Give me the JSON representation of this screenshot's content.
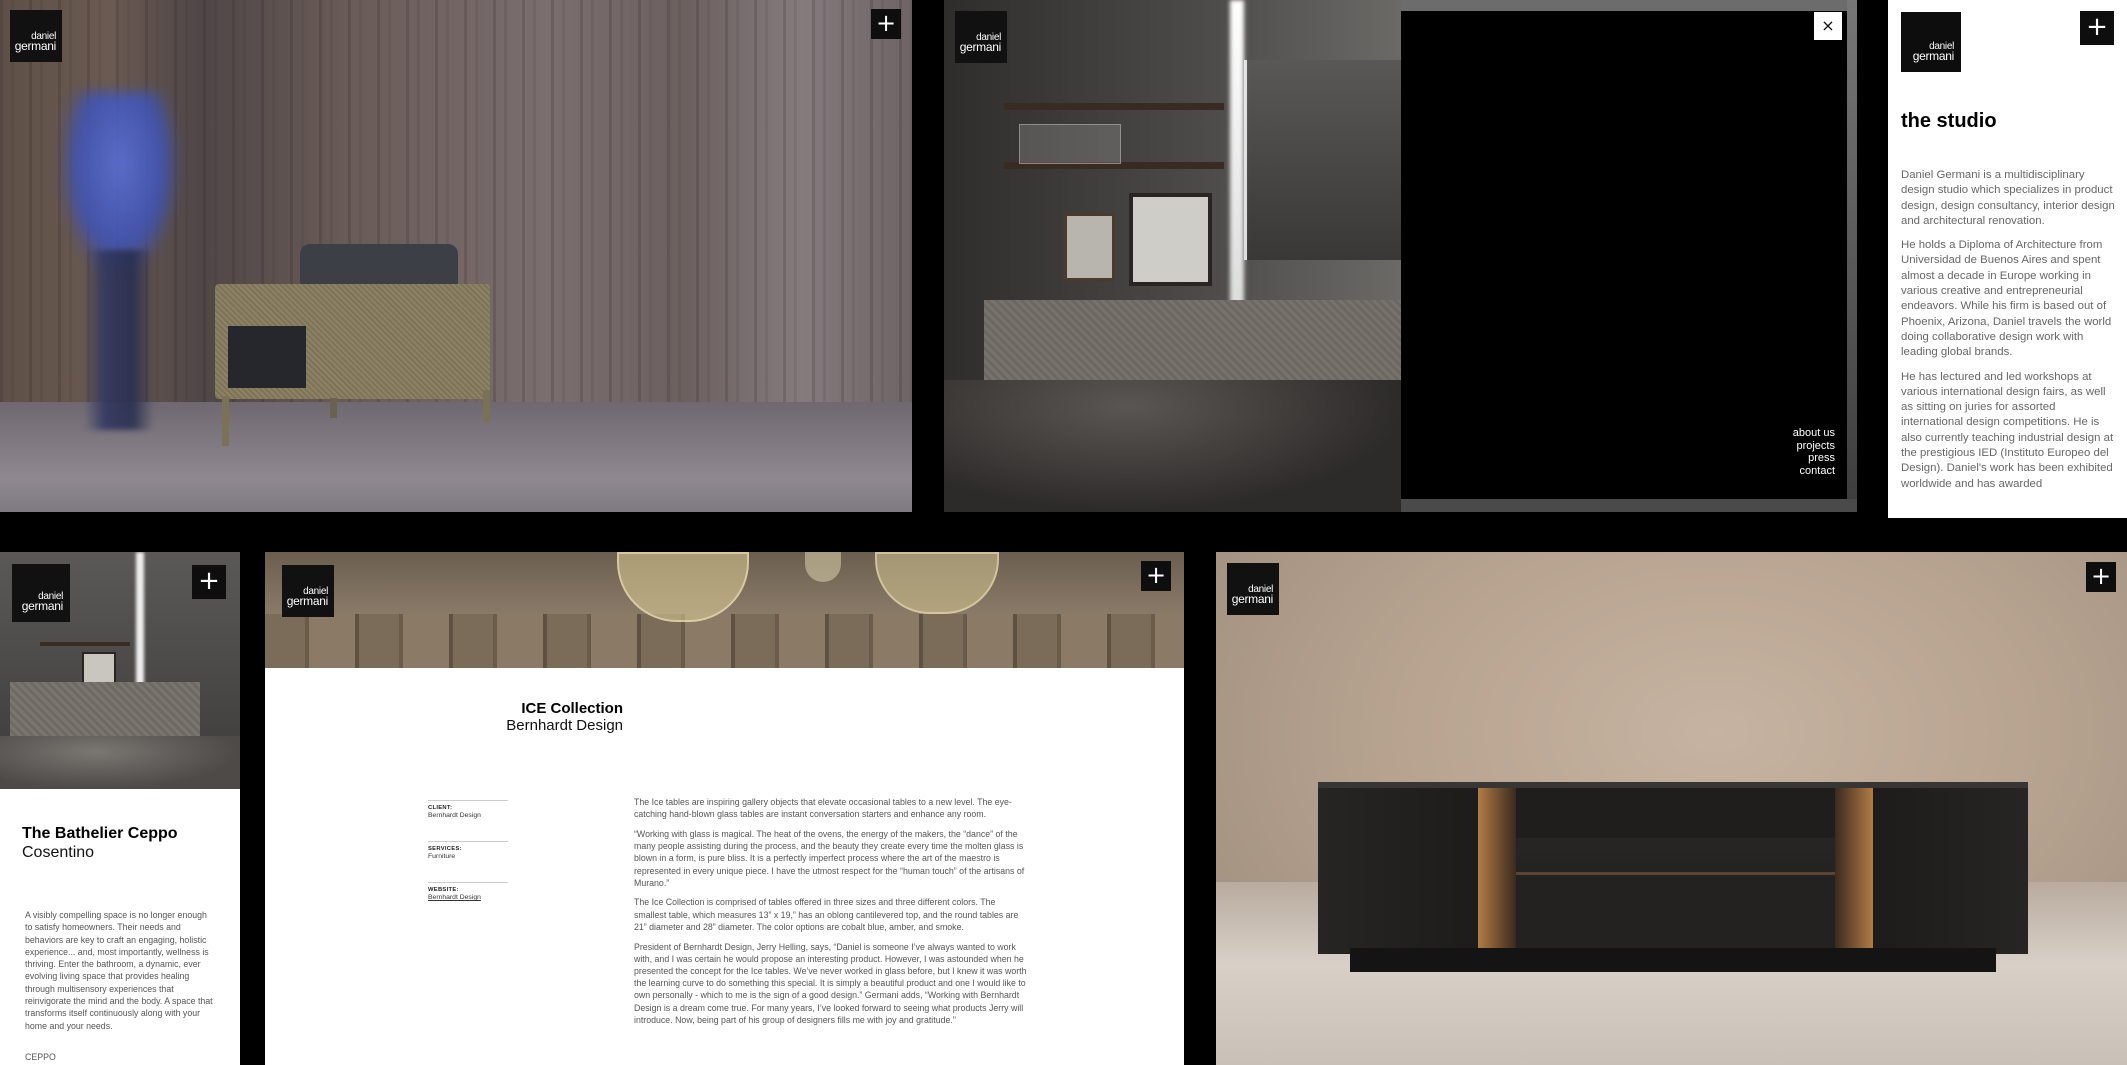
{
  "brand": {
    "line1": "daniel",
    "line2": "germani"
  },
  "buttons": {
    "plus": "+",
    "close": "×"
  },
  "overlay_menu": {
    "items": [
      "about us",
      "projects",
      "press",
      "contact"
    ]
  },
  "studio": {
    "title": "the studio",
    "paragraphs": [
      "Daniel Germani is a multidisciplinary design studio which specializes in product design, design consultancy, interior design and architectural renovation.",
      "He holds a Diploma of Architecture from Universidad de Buenos Aires and spent almost a decade in Europe working in various creative and entrepreneurial endeavors. While his firm is based out of Phoenix, Arizona, Daniel travels the world doing collaborative design work with leading global brands.",
      "He has lectured and led workshops at various international design fairs, as well as sitting on juries for assorted international design competitions. He is also currently teaching industrial design at the prestigious IED (Instituto Europeo del Design). Daniel's work has been exhibited worldwide and has awarded"
    ]
  },
  "bathelier": {
    "title": "The Bathelier Ceppo",
    "subtitle": "Cosentino",
    "body": "A visibly compelling space is no longer enough to satisfy homeowners. Their needs and behaviors are key to craft an engaging, holistic experience... and, most importantly, wellness is thriving. Enter the bathroom, a dynamic, ever evolving living space that provides healing through multisensory experiences that reinvigorate the mind and the body. A space that transforms itself continuously along with your home and your needs.",
    "tag": "CEPPO"
  },
  "ice": {
    "title": "ICE Collection",
    "subtitle": "Bernhardt Design",
    "meta": [
      {
        "key": "CLIENT:",
        "value": "Bernhardt Design"
      },
      {
        "key": "SERVICES:",
        "value": "Furniture"
      },
      {
        "key": "WEBSITE:",
        "value": "Bernhardt Design"
      }
    ],
    "paragraphs": [
      "The Ice tables are inspiring gallery objects that elevate occasional tables to a new level. The eye-catching hand-blown glass tables are instant conversation starters and enhance any room.",
      "“Working with glass is magical. The heat of the ovens, the energy of the makers, the “dance” of the many people assisting during the process, and the beauty they create every time the molten glass is blown in a form, is pure bliss. It is a perfectly imperfect process where the art of the maestro is represented in every unique piece. I have the utmost respect for the “human touch” of the artisans of Murano.”",
      "The Ice Collection is comprised of tables offered in three sizes and three different colors. The smallest table, which measures 13” x 19,” has an oblong cantilevered top, and the round tables are 21” diameter and 28” diameter. The color options are cobalt blue, amber, and smoke.",
      "President of Bernhardt Design, Jerry Helling, says, “Daniel is someone I’ve always wanted to work with, and I was certain he would propose an interesting product. However, I was astounded when he presented the concept for the Ice tables. We’ve never worked in glass before, but I knew it was worth the learning curve to do something this special. It is simply a beautiful product and one I would like to own personally - which to me is the sign of a good design.” Germani adds, “Working with Bernhardt Design is a dream come true. For many years, I’ve looked forward to seeing what products Jerry will introduce. Now, being part of his group of designers fills me with joy and gratitude.”"
    ]
  },
  "colors": {
    "background": "#000000",
    "text": "#000000",
    "body_text": "#666666",
    "button_bg": "#0e0e0e"
  }
}
